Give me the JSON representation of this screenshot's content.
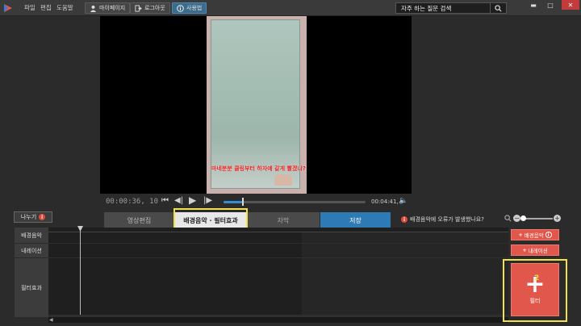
{
  "app": {
    "menu": [
      "파일",
      "편집",
      "도움말"
    ],
    "top_buttons": [
      {
        "label": "마이페이지",
        "icon": "user-icon"
      },
      {
        "label": "로그아웃",
        "icon": "logout-icon"
      },
      {
        "label": "사용법",
        "icon": "info-icon"
      }
    ],
    "search_placeholder": "자주 하는 질문 검색",
    "window_controls": {
      "minimize": "▬",
      "maximize": "□",
      "close": "✕"
    }
  },
  "video": {
    "subtitle_text": "마네분분 클링부터 하자예 같게 빨겠냐?"
  },
  "player": {
    "current_time": "00:00:36, 10",
    "duration": "00:04:41, 9",
    "progress": 0.13
  },
  "tabs": {
    "split_label": "나누기",
    "edit": "영상편집",
    "bgm_filter": "배경음악 · 필터효과",
    "subtitle": "자막",
    "save": "저장"
  },
  "annotations": {
    "one": "1",
    "two": "2"
  },
  "error_question": "배경음악에 오류가 발생했나요?",
  "tracks": [
    "배경음악",
    "내레이션",
    "필터효과"
  ],
  "add_buttons": {
    "bgm": "배경음악",
    "narration": "내레이션",
    "filter": "필터"
  },
  "colors": {
    "accent_red": "#e2574c",
    "save_blue": "#2d7ab4",
    "highlight_yellow": "#f2e24a"
  }
}
